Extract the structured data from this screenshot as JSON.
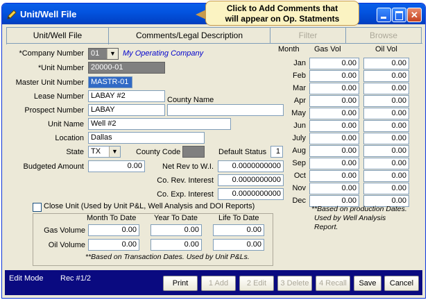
{
  "window": {
    "title": "Unit/Well File"
  },
  "callout": {
    "line1": "Click to Add Comments that",
    "line2": "will appear on Op. Statments"
  },
  "tabs": [
    {
      "label": "Unit/Well File"
    },
    {
      "label": "Comments/Legal Description"
    },
    {
      "label": "Filter"
    },
    {
      "label": "Browse"
    }
  ],
  "form": {
    "company_number": {
      "label": "*Company Number",
      "value": "01",
      "company_name": "My Operating Company"
    },
    "unit_number": {
      "label": "*Unit Number",
      "value": "20000-01"
    },
    "master_unit_number": {
      "label": "Master Unit Number",
      "value": "MASTR-01"
    },
    "lease_number": {
      "label": "Lease Number",
      "value": "LABAY #2"
    },
    "county_name": {
      "label": "County Name",
      "value": ""
    },
    "prospect_number": {
      "label": "Prospect Number",
      "value": "LABAY"
    },
    "unit_name": {
      "label": "Unit Name",
      "value": "Well #2"
    },
    "location": {
      "label": "Location",
      "value": "Dallas"
    },
    "state": {
      "label": "State",
      "value": "TX"
    },
    "county_code": {
      "label": "County Code",
      "value": ""
    },
    "default_status": {
      "label": "Default Status",
      "value": "1"
    },
    "budgeted_amount": {
      "label": "Budgeted Amount",
      "value": "0.00"
    },
    "net_rev_wi": {
      "label": "Net Rev to W.I.",
      "value": "0.0000000000"
    },
    "co_rev_interest": {
      "label": "Co. Rev. Interest",
      "value": "0.0000000000"
    },
    "co_exp_interest": {
      "label": "Co. Exp. Interest",
      "value": "0.0000000000"
    }
  },
  "monthly": {
    "headers": {
      "month": "Month",
      "gas": "Gas  Vol",
      "oil": "Oil  Vol"
    },
    "rows": [
      {
        "month": "Jan",
        "gas": "0.00",
        "oil": "0.00"
      },
      {
        "month": "Feb",
        "gas": "0.00",
        "oil": "0.00"
      },
      {
        "month": "Mar",
        "gas": "0.00",
        "oil": "0.00"
      },
      {
        "month": "Apr",
        "gas": "0.00",
        "oil": "0.00"
      },
      {
        "month": "May",
        "gas": "0.00",
        "oil": "0.00"
      },
      {
        "month": "Jun",
        "gas": "0.00",
        "oil": "0.00"
      },
      {
        "month": "July",
        "gas": "0.00",
        "oil": "0.00"
      },
      {
        "month": "Aug",
        "gas": "0.00",
        "oil": "0.00"
      },
      {
        "month": "Sep",
        "gas": "0.00",
        "oil": "0.00"
      },
      {
        "month": "Oct",
        "gas": "0.00",
        "oil": "0.00"
      },
      {
        "month": "Nov",
        "gas": "0.00",
        "oil": "0.00"
      },
      {
        "month": "Dec",
        "gas": "0.00",
        "oil": "0.00"
      }
    ],
    "note": [
      "**Based on production Dates.",
      "Used by Well Analysis",
      "Report."
    ]
  },
  "close_unit": {
    "label": "Close Unit (Used by Unit P&L, Well Analysis and DOI Reports)",
    "checked": false
  },
  "totals": {
    "headers": {
      "mtd": "Month To Date",
      "ytd": "Year To Date",
      "ltd": "Life To Date"
    },
    "gas": {
      "label": "Gas Volume",
      "mtd": "0.00",
      "ytd": "0.00",
      "ltd": "0.00"
    },
    "oil": {
      "label": "Oil Volume",
      "mtd": "0.00",
      "ytd": "0.00",
      "ltd": "0.00"
    },
    "note": "**Based on Transaction Dates.  Used by Unit P&Ls."
  },
  "status": {
    "mode": "Edit Mode",
    "record": "Rec #1/2"
  },
  "buttons": {
    "print": "Print",
    "add": "1 Add",
    "edit": "2 Edit",
    "delete": "3 Delete",
    "recall": "4 Recall",
    "save": "Save",
    "cancel": "Cancel"
  },
  "colors": {
    "titlebar": "#0354e0",
    "statusbar": "#0a0a80",
    "callout": "#fbf3c2",
    "disabled_text": "#aca899"
  }
}
